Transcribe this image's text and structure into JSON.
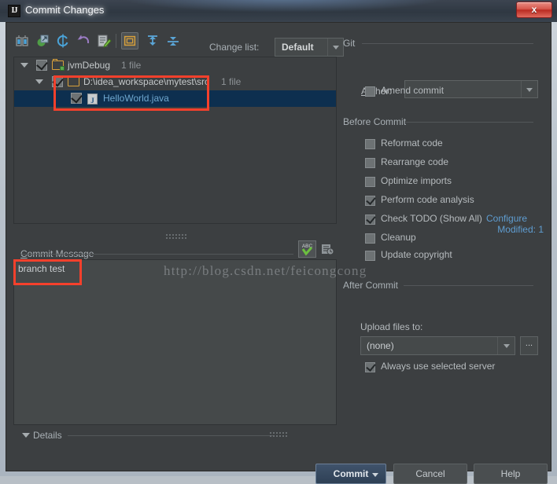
{
  "window": {
    "title": "Commit Changes",
    "app_icon": "intellij-idea-icon",
    "close_label": "x"
  },
  "toolbar": {
    "buttons": [
      {
        "name": "show-diff-icon",
        "label": "Show Diff"
      },
      {
        "name": "revert-from-icon",
        "label": "Move to Another Changelist"
      },
      {
        "name": "refresh-icon",
        "label": "Refresh"
      },
      {
        "name": "rollback-icon",
        "label": "Rollback"
      },
      {
        "name": "edit-source-icon",
        "label": "Edit Source"
      },
      {
        "name": "group-by-directory-icon",
        "label": "Group By Directory"
      },
      {
        "name": "expand-all-icon",
        "label": "Expand All"
      },
      {
        "name": "collapse-all-icon",
        "label": "Collapse All"
      }
    ],
    "changelist_label": "Change list:",
    "changelist_value": "Default"
  },
  "tree": {
    "nodes": [
      {
        "label": "jvmDebug",
        "count": "1 file",
        "icon": "changelist-folder-icon",
        "checked": true,
        "expanded": true,
        "depth": 0,
        "selected": false,
        "type": "changelist"
      },
      {
        "label": "D:\\idea_workspace\\mytest\\src",
        "count": "1 file",
        "icon": "folder-icon",
        "checked": true,
        "expanded": true,
        "depth": 1,
        "selected": false,
        "type": "directory"
      },
      {
        "label": "HelloWorld.java",
        "count": "",
        "icon": "java-file-icon",
        "checked": true,
        "expanded": false,
        "depth": 2,
        "selected": true,
        "type": "file"
      }
    ],
    "modified_count": "Modified: 1"
  },
  "commit_message": {
    "section_label": "Commit Message",
    "text": "branch test",
    "spellcheck_icon": "abc-spellcheck-icon",
    "history_icon": "message-history-icon"
  },
  "watermark": "http://blog.csdn.net/feicongcong",
  "details": {
    "label": "Details",
    "expanded": true
  },
  "git": {
    "section_label": "Git",
    "author_label": "Author:",
    "author_value": "",
    "amend_commit": {
      "label": "Amend commit",
      "checked": false
    }
  },
  "before_commit": {
    "section_label": "Before Commit",
    "options": [
      {
        "label": "Reformat code",
        "checked": false
      },
      {
        "label": "Rearrange code",
        "checked": false
      },
      {
        "label": "Optimize imports",
        "checked": false
      },
      {
        "label": "Perform code analysis",
        "checked": true
      },
      {
        "label": "Check TODO (Show All)",
        "checked": true
      },
      {
        "label": "Cleanup",
        "checked": false
      },
      {
        "label": "Update copyright",
        "checked": false
      }
    ],
    "configure_link": "Configure"
  },
  "after_commit": {
    "section_label": "After Commit",
    "upload_label": "Upload files to:",
    "upload_value": "(none)",
    "browse_label": "...",
    "always_use_selected_server": {
      "label": "Always use selected server",
      "checked": true
    }
  },
  "footer": {
    "commit_label": "Commit",
    "cancel_label": "Cancel",
    "help_label": "Help"
  },
  "colors": {
    "accent_link": "#5f9dd1",
    "selection": "#0d2f4f",
    "annotation": "#f5402c",
    "panel_bg": "#3c3f41"
  }
}
